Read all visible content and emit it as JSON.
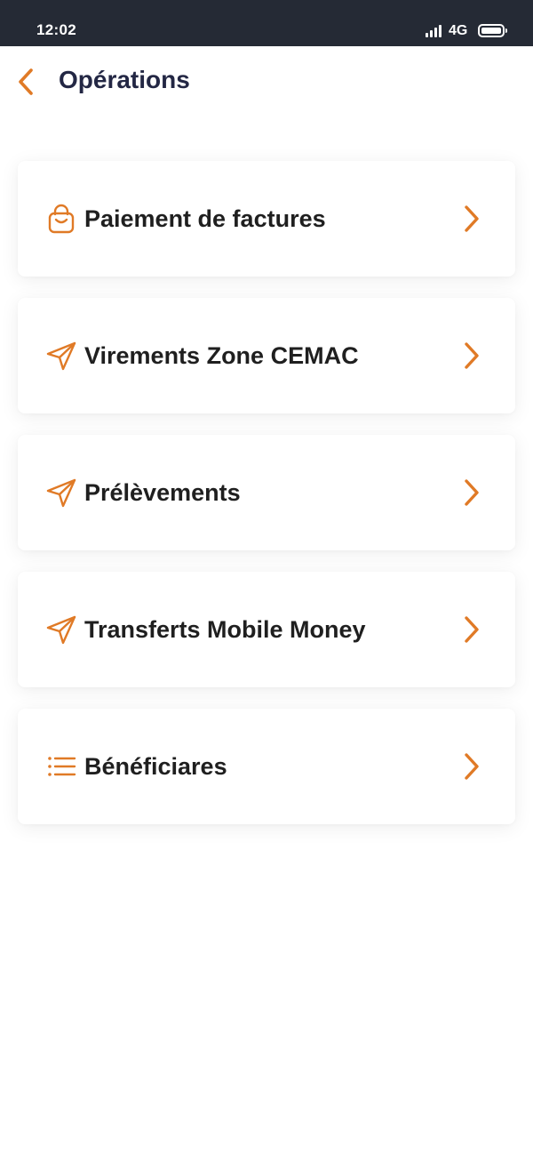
{
  "status_bar": {
    "time": "12:02",
    "network": "4G"
  },
  "header": {
    "title": "Opérations",
    "back_icon": "chevron-left-icon"
  },
  "menu": {
    "items": [
      {
        "label": "Paiement de factures",
        "icon": "shopping-bag-icon"
      },
      {
        "label": "Virements Zone CEMAC",
        "icon": "send-icon"
      },
      {
        "label": "Prélèvements",
        "icon": "send-icon"
      },
      {
        "label": "Transferts Mobile Money",
        "icon": "send-icon"
      },
      {
        "label": "Bénéficiares",
        "icon": "list-icon"
      }
    ]
  },
  "colors": {
    "accent": "#e07a26",
    "title": "#232744",
    "status_bar_bg": "#252a35"
  }
}
